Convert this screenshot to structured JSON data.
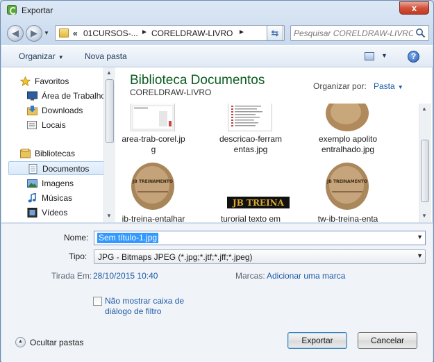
{
  "window": {
    "title": "Exportar",
    "close_label": "x"
  },
  "address": {
    "overflow": "«",
    "segments": [
      "01CURSOS-...",
      "CORELDRAW-LIVRO"
    ],
    "search_placeholder": "Pesquisar CORELDRAW-LIVRO"
  },
  "toolbar": {
    "organize": "Organizar",
    "new_folder": "Nova pasta",
    "help": "?"
  },
  "sidebar": {
    "items": [
      {
        "label": "Favoritos",
        "icon": "star-icon"
      },
      {
        "label": "Área de Trabalho",
        "icon": "desktop-icon"
      },
      {
        "label": "Downloads",
        "icon": "downloads-icon"
      },
      {
        "label": "Locais",
        "icon": "recent-places-icon"
      },
      {
        "label": "Bibliotecas",
        "icon": "libraries-icon"
      },
      {
        "label": "Documentos",
        "icon": "documents-icon",
        "selected": true
      },
      {
        "label": "Imagens",
        "icon": "pictures-icon"
      },
      {
        "label": "Músicas",
        "icon": "music-icon"
      },
      {
        "label": "Vídeos",
        "icon": "videos-icon"
      }
    ]
  },
  "content": {
    "title": "Biblioteca Documentos",
    "subtitle": "CORELDRAW-LIVRO",
    "organize_label": "Organizar por:",
    "organize_value": "Pasta",
    "files": [
      {
        "name1": "area-trab-corel.jp",
        "name2": "g"
      },
      {
        "name1": "descricao-ferram",
        "name2": "entas.jpg"
      },
      {
        "name1": "exemplo apolito",
        "name2": "entralhado.jpg"
      },
      {
        "name1": "ib-treina-entalhar",
        "name2": ""
      },
      {
        "name1": "turorial texto em",
        "name2": ""
      },
      {
        "name1": "tw-ib-treina-enta",
        "name2": ""
      }
    ],
    "thumb_texts": {
      "jb_treina": "JB TREINA",
      "stone_logo": "JB TREINAMENTO"
    }
  },
  "footer": {
    "name_label": "Nome:",
    "name_value": "Sem título-1.jpg",
    "type_label": "Tipo:",
    "type_value": "JPG - Bitmaps JPEG (*.jpg;*.jtf;*.jff;*.jpeg)",
    "taken_label": "Tirada Em:",
    "taken_value": "28/10/2015 10:40",
    "tags_label": "Marcas:",
    "tags_value": "Adicionar uma marca",
    "checkbox_line1": "Não mostrar caixa de",
    "checkbox_line2": "diálogo de filtro",
    "hide_folders": "Ocultar pastas",
    "export_button": "Exportar",
    "cancel_button": "Cancelar"
  },
  "colors": {
    "accent_link": "#1d5aa8",
    "library_title": "#0b5c20",
    "selection": "#3399ff"
  }
}
